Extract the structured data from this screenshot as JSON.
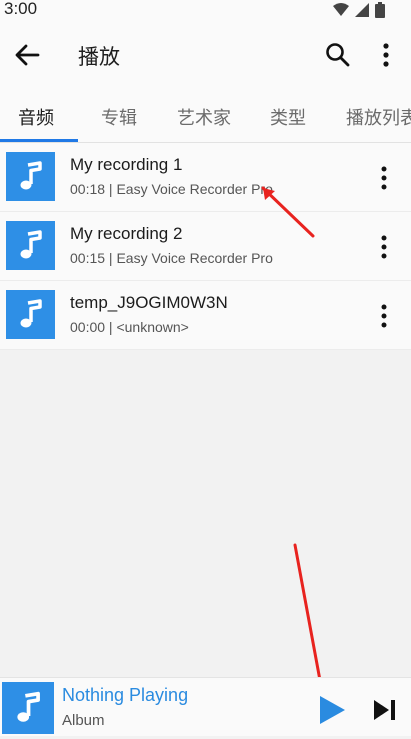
{
  "status_bar": {
    "time": "3:00",
    "icons": [
      "wifi-icon",
      "signal-icon",
      "battery-icon"
    ]
  },
  "app_bar": {
    "title": "播放",
    "back_icon": "back-arrow-icon",
    "search_icon": "search-icon",
    "more_icon": "more-vert-icon"
  },
  "tabs": [
    {
      "label": "音频",
      "active": true
    },
    {
      "label": "专辑",
      "active": false
    },
    {
      "label": "艺术家",
      "active": false
    },
    {
      "label": "类型",
      "active": false
    },
    {
      "label": "播放列表",
      "active": false
    }
  ],
  "tracks": [
    {
      "name": "My recording 1",
      "meta": "00:18 | Easy Voice Recorder Pro"
    },
    {
      "name": "My recording 2",
      "meta": "00:15 | Easy Voice Recorder Pro"
    },
    {
      "name": "temp_J9OGIM0W3N",
      "meta": "00:00 | <unknown>"
    }
  ],
  "player": {
    "title": "Nothing Playing",
    "album": "Album",
    "play_icon": "play-icon",
    "next_icon": "skip-next-icon"
  },
  "colors": {
    "accent": "#2079e6",
    "art": "#2e8fe6",
    "annotation": "#e8231f"
  }
}
